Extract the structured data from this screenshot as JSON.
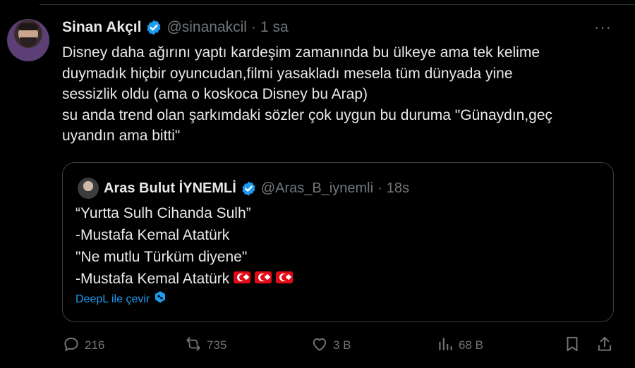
{
  "tweet": {
    "author_name": "Sinan Akçıl",
    "handle": "@sinanakcil",
    "separator": "·",
    "time": "1 sa",
    "more": "···",
    "lines": [
      "Disney daha ağırını yaptı kardeşim zamanında bu ülkeye ama tek kelime",
      "duymadık hiçbir oyuncudan,filmi yasakladı mesela tüm dünyada yine",
      "sessizlik oldu (ama o koskoca Disney bu Arap)",
      "su anda trend olan şarkımdaki sözler çok uygun bu duruma \"Günaydın,geç",
      "uyandın ama bitti\""
    ]
  },
  "quote": {
    "author_name": "Aras Bulut İYNEMLİ",
    "handle": "@Aras_B_iynemli",
    "separator": "·",
    "time": "18s",
    "lines": [
      "“Yurtta Sulh Cihanda Sulh”",
      "-Mustafa Kemal Atatürk",
      "\"Ne mutlu Türküm diyene\"",
      "-Mustafa Kemal Atatürk"
    ],
    "flag_count": 3,
    "translate_label": "DeepL ile çevir"
  },
  "actions": {
    "replies": "216",
    "retweets": "735",
    "likes": "3 B",
    "views": "68 B"
  },
  "colors": {
    "background": "#000000",
    "text": "#e7e9ea",
    "muted": "#71767b",
    "accent": "#1d9bf0",
    "flag_red": "#e30a17"
  },
  "icons": {
    "verified": "verified-badge-icon",
    "reply": "reply-icon",
    "retweet": "retweet-icon",
    "like": "heart-icon",
    "views": "views-chart-icon",
    "bookmark": "bookmark-icon",
    "share": "share-icon",
    "deepl": "deepl-icon"
  }
}
